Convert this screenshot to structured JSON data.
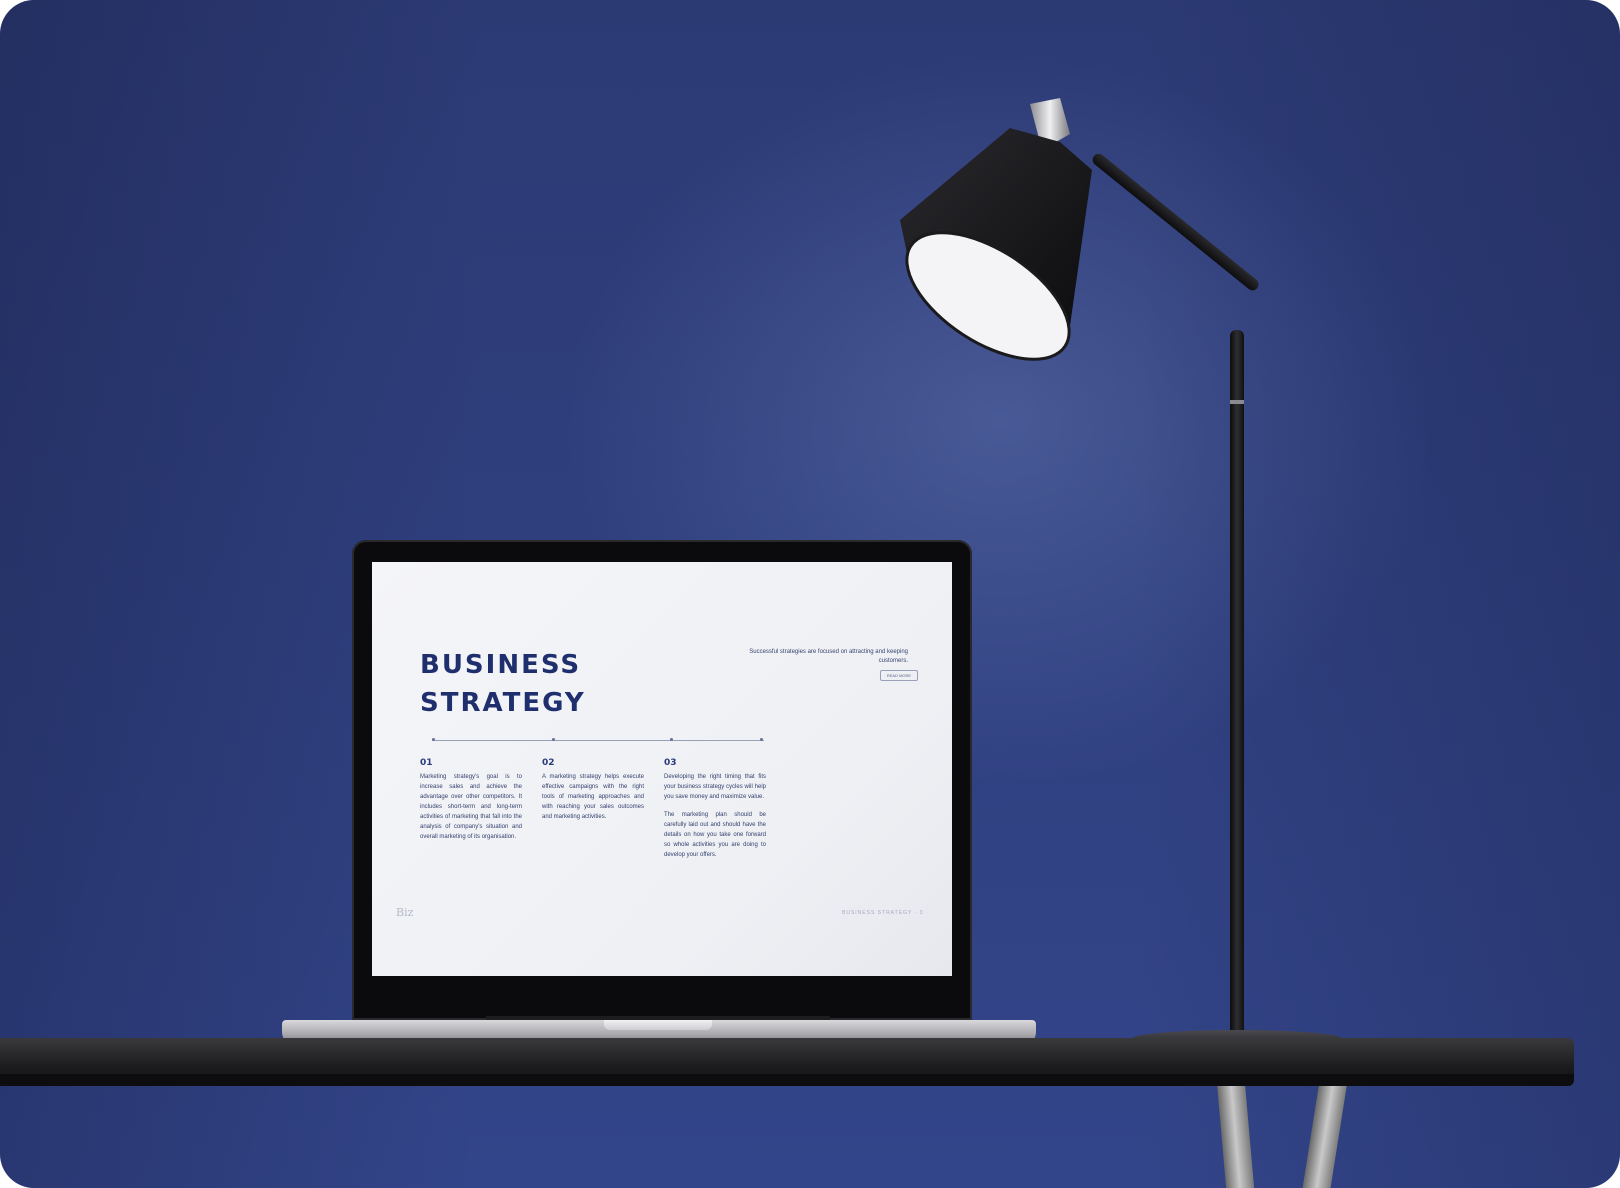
{
  "scene": {
    "description_colors": {
      "wall": "#2f3f7e",
      "table": "#1c1c1e",
      "screen_bg": "#f1f2f6",
      "accent_text": "#1f2f6e"
    }
  },
  "slide": {
    "title_line1": "BUSINESS",
    "title_line2": "STRATEGY",
    "tagline": "Successful strategies are focused on attracting and keeping customers.",
    "read_more": "READ MORE",
    "columns": [
      {
        "number": "01",
        "paragraphs": [
          "Marketing strategy's goal is to increase sales and achieve the advantage over other competitors. It includes short-term and long-term activities of marketing that fall into the analysis of company's situation and overall marketing of its organisation."
        ]
      },
      {
        "number": "02",
        "paragraphs": [
          "A marketing strategy helps execute effective campaigns with the right tools of marketing approaches and with reaching your sales outcomes and marketing activities."
        ]
      },
      {
        "number": "03",
        "paragraphs": [
          "Developing the right timing that fits your business strategy cycles will help you save money and maximize value.",
          "The marketing plan should be carefully laid out and should have the details on how you take one forward so whole activities you are doing to develop your offers."
        ]
      }
    ],
    "footer_logo": "Biz",
    "footer_right": "BUSINESS STRATEGY · 3"
  }
}
